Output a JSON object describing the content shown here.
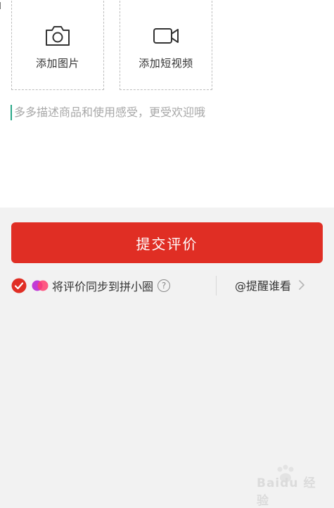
{
  "upload": {
    "photo_label": "添加图片",
    "video_label": "添加短视频"
  },
  "review": {
    "placeholder": "多多描述商品和使用感受，更受欢迎哦",
    "value": ""
  },
  "submit": {
    "label": "提交评价",
    "color": "#e02e24"
  },
  "sync": {
    "checked": true,
    "label": "将评价同步到拼小圈",
    "help": "?"
  },
  "mention": {
    "label": "@提醒谁看"
  },
  "watermark": {
    "text": "Baidu 经验"
  },
  "icons": [
    "camera-icon",
    "video-camera-icon",
    "check-circle-icon",
    "circles-logo-icon",
    "help-icon",
    "chevron-right-icon",
    "baidu-paw-icon"
  ]
}
